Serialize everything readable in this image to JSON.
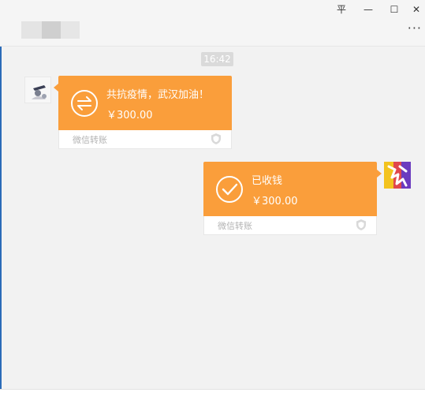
{
  "window": {
    "controls": {
      "pin": "平",
      "minimize": "—",
      "maximize": "☐",
      "close": "✕"
    },
    "more_label": "···"
  },
  "chat": {
    "timestamp": "16:42",
    "messages": [
      {
        "sender": "contact",
        "type": "transfer",
        "title": "共抗疫情，武汉加油！",
        "amount": "￥300.00",
        "footer": "微信转账",
        "icon": "transfer-arrows-icon",
        "bubble_color": "#fa9e3b"
      },
      {
        "sender": "self",
        "type": "transfer",
        "title": "已收钱",
        "amount": "￥300.00",
        "footer": "微信转账",
        "icon": "check-icon",
        "bubble_color": "#fa9e3b"
      }
    ]
  }
}
